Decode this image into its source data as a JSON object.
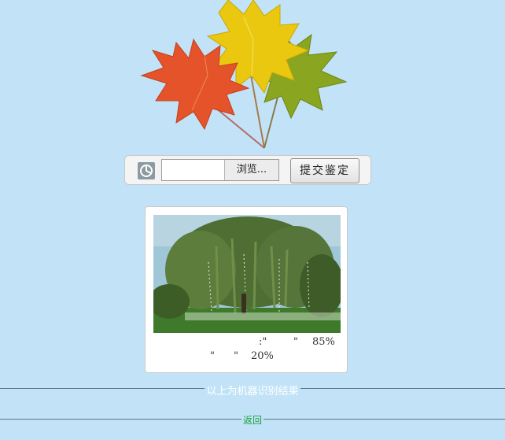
{
  "upload": {
    "browse_label": "浏览...",
    "submit_label": "提交鉴定"
  },
  "result": {
    "line1": {
      "q1": ":\"",
      "q2": "\"",
      "pct": "85%"
    },
    "line2": {
      "q1": "\"",
      "q2": "\"",
      "pct": "20%"
    }
  },
  "caption": "以上为机器识别结果",
  "back_label": "返回",
  "colors": {
    "background": "#c2e3f7",
    "link_green": "#18a03a",
    "caption_white": "#ffffff"
  }
}
